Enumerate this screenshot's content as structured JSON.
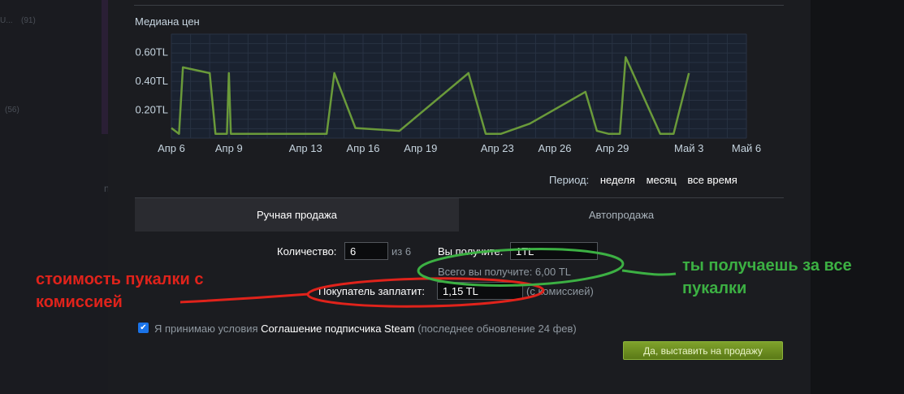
{
  "background": {
    "items": [
      {
        "text": "U...",
        "count": "(91)"
      },
      {
        "text": "",
        "count": "(56)"
      }
    ],
    "stray": "n"
  },
  "chart_data": {
    "type": "line",
    "title": "Медиана цен",
    "x_tick_labels": [
      "Апр 6",
      "Апр 9",
      "Апр 13",
      "Апр 16",
      "Апр 19",
      "Апр 23",
      "Апр 26",
      "Апр 29",
      "Май 3",
      "Май 6"
    ],
    "x_tick_days": [
      0,
      3,
      7,
      10,
      13,
      17,
      20,
      23,
      27,
      30
    ],
    "y_tick_labels": [
      "0.60TL",
      "0.40TL",
      "0.20TL"
    ],
    "y_tick_values": [
      0.6,
      0.4,
      0.2
    ],
    "ylim": [
      0.0,
      0.72
    ],
    "xlim": [
      0,
      30
    ],
    "grid": true,
    "series": [
      {
        "color": "#6a9a3a",
        "points": [
          [
            0.0,
            0.07
          ],
          [
            0.4,
            0.03
          ],
          [
            0.6,
            0.49
          ],
          [
            2.0,
            0.45
          ],
          [
            2.3,
            0.03
          ],
          [
            2.9,
            0.03
          ],
          [
            3.0,
            0.45
          ],
          [
            3.1,
            0.03
          ],
          [
            8.1,
            0.03
          ],
          [
            8.5,
            0.45
          ],
          [
            9.6,
            0.07
          ],
          [
            11.9,
            0.05
          ],
          [
            15.5,
            0.45
          ],
          [
            16.4,
            0.03
          ],
          [
            17.2,
            0.03
          ],
          [
            18.7,
            0.1
          ],
          [
            21.6,
            0.32
          ],
          [
            22.2,
            0.05
          ],
          [
            22.8,
            0.03
          ],
          [
            23.4,
            0.03
          ],
          [
            23.7,
            0.56
          ],
          [
            25.5,
            0.03
          ],
          [
            26.2,
            0.03
          ],
          [
            27.0,
            0.45
          ]
        ]
      }
    ]
  },
  "period": {
    "label": "Период:",
    "options": [
      "неделя",
      "месяц",
      "все время"
    ]
  },
  "tabs": {
    "manual": "Ручная продажа",
    "auto": "Автопродажа"
  },
  "form": {
    "quantity_label": "Количество:",
    "quantity_value": "6",
    "quantity_of": "из 6",
    "you_receive_label": "Вы получите:",
    "you_receive_value": "1TL",
    "total_receive": "Всего вы получите: 6,00 TL",
    "buyer_pays_label": "Покупатель заплатит:",
    "buyer_pays_value": "1,15 TL",
    "with_fee": "(с комиссией)"
  },
  "agreement": {
    "checked": true,
    "prefix": "Я принимаю условия",
    "link": "Соглашение подписчика Steam",
    "suffix": "(последнее обновление 24 фев)"
  },
  "submit_label": "Да, выставить на продажу",
  "annotations": {
    "red": [
      "стоимость пукалки с",
      "комиссией"
    ],
    "green": [
      "ты получаешь за все",
      "пукалки"
    ],
    "red_color": "#e0231b",
    "green_color": "#3cb043"
  }
}
